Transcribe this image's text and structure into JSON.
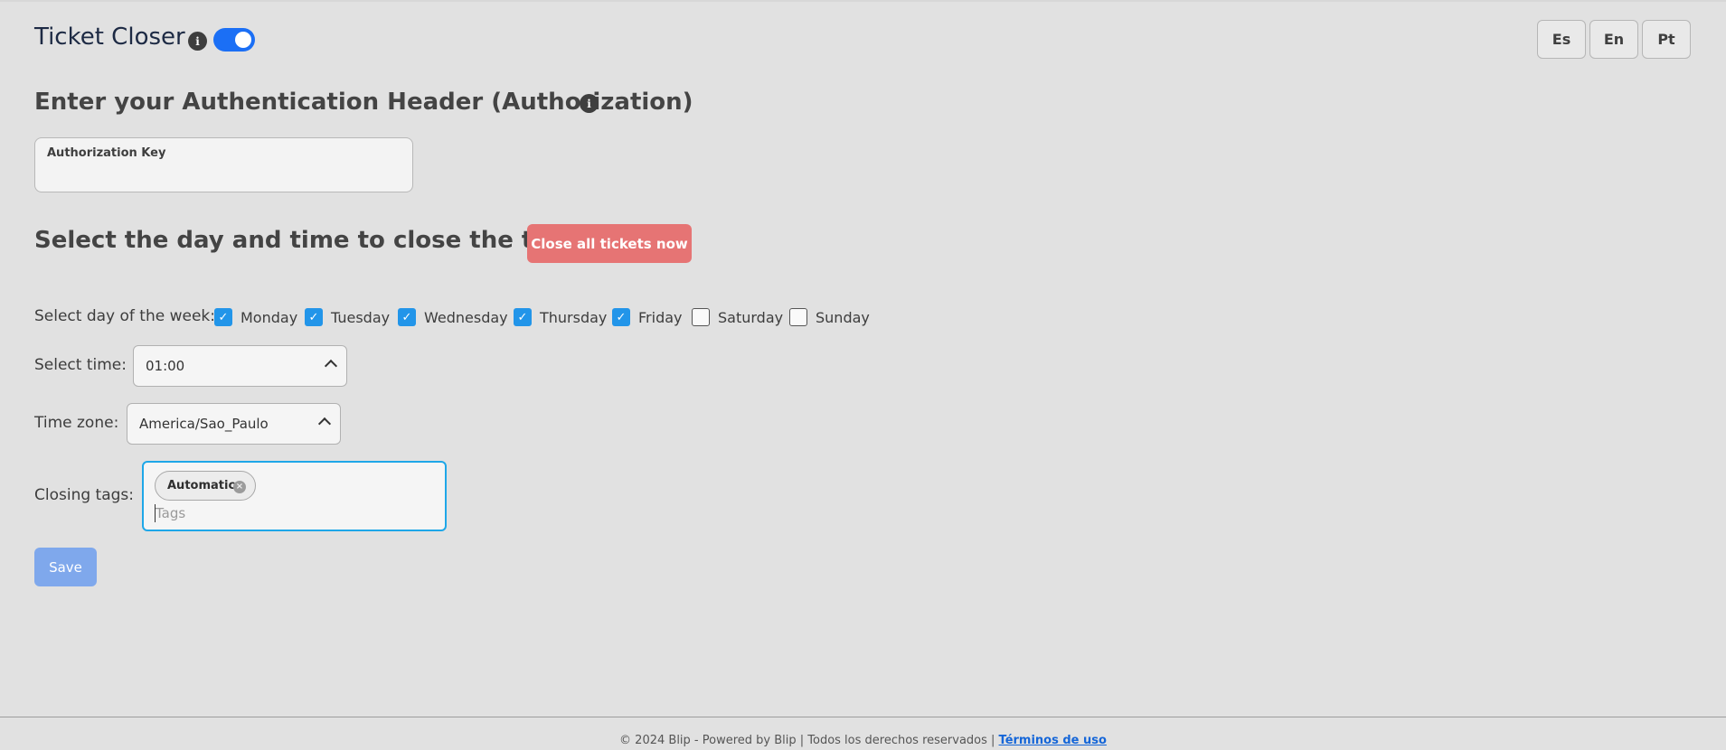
{
  "header": {
    "title": "Ticket Closer",
    "info_icon": "i",
    "toggle_on": true,
    "languages": [
      "Es",
      "En",
      "Pt"
    ]
  },
  "auth": {
    "heading": "Enter your Authentication Header (Authorization)",
    "info_icon": "i",
    "field_label": "Authorization Key",
    "field_value": ""
  },
  "schedule": {
    "heading": "Select the day and time to close the tickets.",
    "close_all_label": "Close all tickets now",
    "day_label": "Select day of the week:",
    "days": [
      {
        "label": "Monday",
        "checked": true
      },
      {
        "label": "Tuesday",
        "checked": true
      },
      {
        "label": "Wednesday",
        "checked": true
      },
      {
        "label": "Thursday",
        "checked": true
      },
      {
        "label": "Friday",
        "checked": true
      },
      {
        "label": "Saturday",
        "checked": false
      },
      {
        "label": "Sunday",
        "checked": false
      }
    ],
    "checkmark": "✓",
    "time_label": "Select time:",
    "time_value": "01:00",
    "timezone_label": "Time zone:",
    "timezone_value": "America/Sao_Paulo",
    "tags_label": "Closing tags:",
    "tags": [
      "Automatic"
    ],
    "tag_remove": "×",
    "tags_placeholder": "Tags",
    "save_label": "Save"
  },
  "footer": {
    "text": "© 2024 Blip - Powered by Blip | Todos los derechos reservados | ",
    "link": "Términos de uso"
  },
  "colors": {
    "background": "#e1e1e1",
    "toggle": "#1b6ff5",
    "checkbox": "#2295e9",
    "danger": "#e67474",
    "save": "#7fa8ec",
    "focus": "#1ea7e8",
    "link": "#1566d8"
  }
}
